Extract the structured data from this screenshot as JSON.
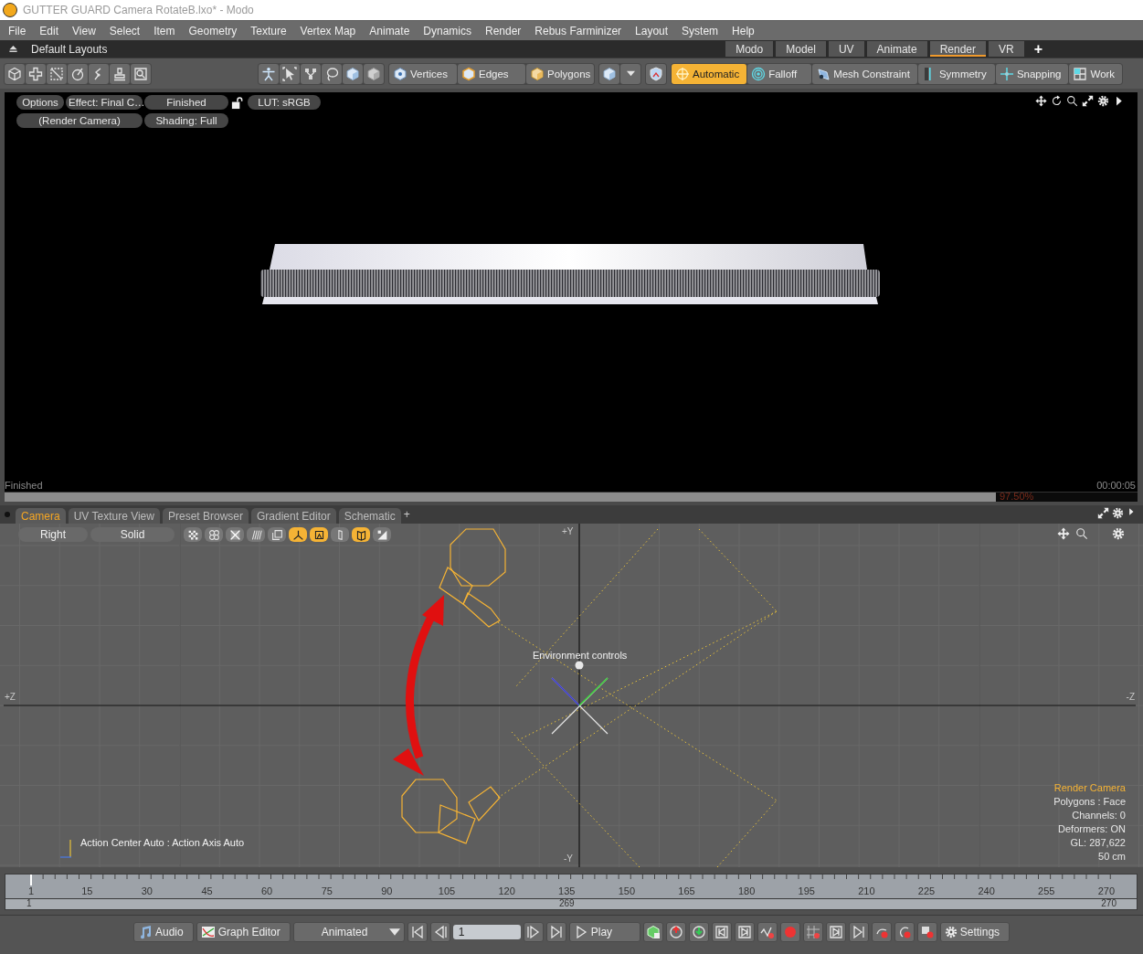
{
  "window": {
    "title": "GUTTER GUARD Camera RotateB.lxo* - Modo"
  },
  "menu": [
    "File",
    "Edit",
    "View",
    "Select",
    "Item",
    "Geometry",
    "Texture",
    "Vertex Map",
    "Animate",
    "Dynamics",
    "Render",
    "Rebus Farminizer",
    "Layout",
    "System",
    "Help"
  ],
  "layout_bar": {
    "label": "Default Layouts",
    "tabs": [
      {
        "label": "Modo",
        "selected": false
      },
      {
        "label": "Model",
        "selected": false
      },
      {
        "label": "UV",
        "selected": false
      },
      {
        "label": "Animate",
        "selected": false
      },
      {
        "label": "Render",
        "selected": true
      },
      {
        "label": "VR",
        "selected": false
      }
    ],
    "add": "+"
  },
  "toolbar": {
    "modes": [
      {
        "label": "Vertices",
        "selected": false
      },
      {
        "label": "Edges",
        "selected": false
      },
      {
        "label": "Polygons",
        "selected": false
      }
    ],
    "tools": [
      {
        "label": "Automatic",
        "selected": true
      },
      {
        "label": "Falloff",
        "selected": false
      },
      {
        "label": "Mesh Constraint",
        "selected": false
      },
      {
        "label": "Symmetry",
        "selected": false
      },
      {
        "label": "Snapping",
        "selected": false
      },
      {
        "label": "Work",
        "selected": false
      }
    ]
  },
  "render_view": {
    "row_1": [
      "Options",
      "Effect: Final C…",
      "Finished",
      "LUT: sRGB"
    ],
    "row_2": [
      "(Render Camera)",
      "Shading: Full"
    ],
    "status": "Finished",
    "time": "00:00:05",
    "progress": {
      "level": 0.875,
      "reading": "97.50%"
    }
  },
  "panel_tabs": [
    {
      "label": "Camera",
      "selected": true
    },
    {
      "label": "UV Texture View",
      "selected": false
    },
    {
      "label": "Preset Browser",
      "selected": false
    },
    {
      "label": "Gradient Editor",
      "selected": false
    },
    {
      "label": "Schematic",
      "selected": false
    }
  ],
  "panel_add": "+",
  "viewport": {
    "view": "Right",
    "shading": "Solid",
    "toggles": [
      {
        "selected": false
      },
      {
        "selected": false
      },
      {
        "selected": false
      },
      {
        "selected": false
      },
      {
        "selected": false
      },
      {
        "selected": true
      },
      {
        "selected": true
      },
      {
        "selected": false
      },
      {
        "selected": true
      },
      {
        "selected": false
      }
    ],
    "axis_labels": {
      "top": "+Y",
      "bottom": "-Y",
      "left": "+Z",
      "right": "-Z"
    },
    "marker_label": "Environment controls",
    "action_center": "Action Center Auto : Action Axis Auto",
    "info": [
      "Render Camera",
      "Polygons : Face",
      "Channels: 0",
      "Deformers: ON",
      "GL: 287,622",
      "50 cm"
    ]
  },
  "timeline": {
    "ticks": [
      "1",
      "15",
      "30",
      "45",
      "60",
      "75",
      "90",
      "105",
      "120",
      "135",
      "150",
      "165",
      "180",
      "195",
      "210",
      "225",
      "240",
      "255",
      "270"
    ],
    "start": "1",
    "current": "269",
    "end": "270"
  },
  "transport": {
    "audio": "Audio",
    "graph_editor": "Graph Editor",
    "mode": "Animated",
    "frame": "1",
    "play": "Play",
    "settings": "Settings"
  }
}
